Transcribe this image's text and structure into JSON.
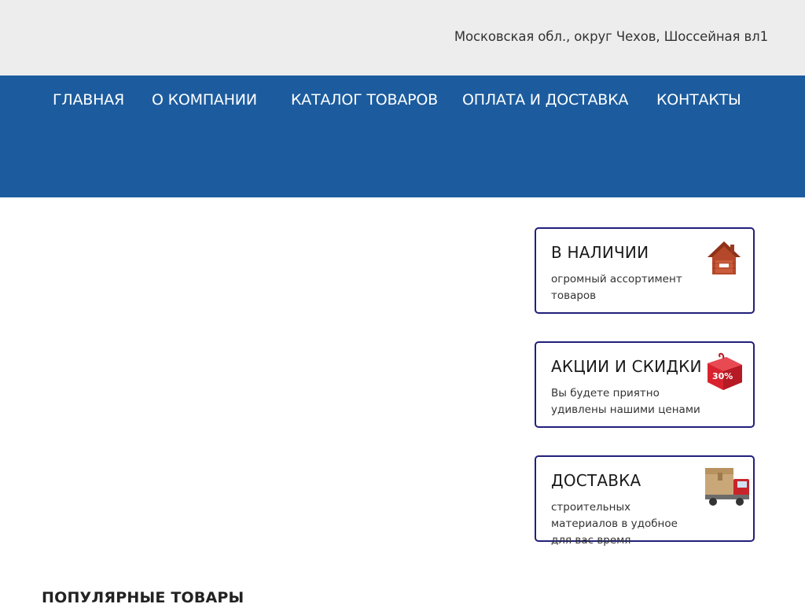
{
  "header": {
    "address": "Московская обл., округ Чехов, Шоссейная вл1"
  },
  "nav": {
    "items": [
      {
        "label": "ГЛАВНАЯ"
      },
      {
        "label": "О КОМПАНИИ"
      },
      {
        "label": "КАТАЛОГ ТОВАРОВ"
      },
      {
        "label": "ОПЛАТА И ДОСТАВКА"
      },
      {
        "label": "КОНТАКТЫ"
      }
    ]
  },
  "features": [
    {
      "title": "В НАЛИЧИИ",
      "text": "огромный ассортимент товаров",
      "icon": "house-icon"
    },
    {
      "title": "АКЦИИ И СКИДКИ",
      "text": "Вы будете приятно удивлены нашими ценами",
      "icon": "discount-gift-icon"
    },
    {
      "title": "ДОСТАВКА",
      "text": "строительных материалов в удобное для вас время",
      "icon": "delivery-truck-icon"
    }
  ],
  "popular": {
    "title": "ПОПУЛЯРНЫЕ ТОВАРЫ"
  },
  "colors": {
    "topbar": "#ededed",
    "nav": "#1c5c9e",
    "card_border": "#22207a"
  }
}
